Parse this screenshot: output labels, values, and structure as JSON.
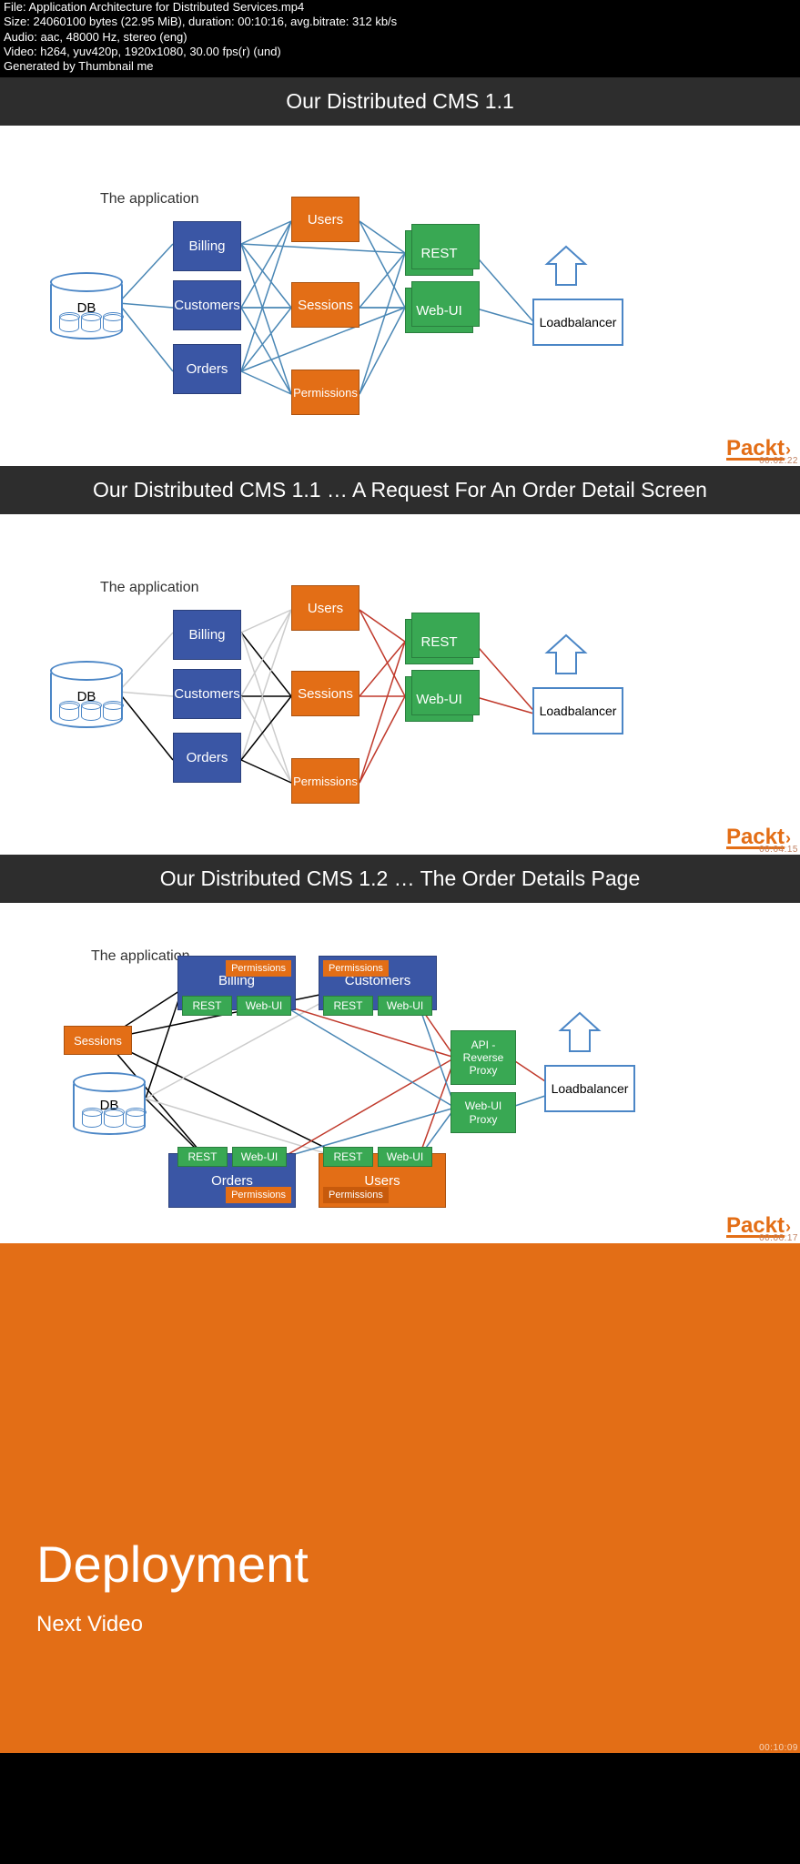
{
  "meta": {
    "file": "File: Application Architecture for Distributed Services.mp4",
    "size": "Size: 24060100 bytes (22.95 MiB), duration: 00:10:16, avg.bitrate: 312 kb/s",
    "audio": "Audio: aac, 48000 Hz, stereo (eng)",
    "video": "Video: h264, yuv420p, 1920x1080, 30.00 fps(r) (und)",
    "gen": "Generated by Thumbnail me"
  },
  "brand": "Packt",
  "db_label": "DB",
  "loadbalancer_label": "Loadbalancer",
  "app_label": "The application",
  "segments": {
    "s1": {
      "title": "Our Distributed CMS 1.1",
      "timestamp": "00:02:22",
      "nodes": {
        "billing": "Billing",
        "customers": "Customers",
        "orders": "Orders",
        "users": "Users",
        "sessions": "Sessions",
        "permissions": "Permissions",
        "rest": "REST",
        "webui": "Web-UI"
      }
    },
    "s2": {
      "title": "Our Distributed CMS 1.1 … A Request For An Order Detail Screen",
      "timestamp": "00:04:15",
      "nodes": {
        "billing": "Billing",
        "customers": "Customers",
        "orders": "Orders",
        "users": "Users",
        "sessions": "Sessions",
        "permissions": "Permissions",
        "rest": "REST",
        "webui": "Web-UI"
      }
    },
    "s3": {
      "title": "Our Distributed CMS 1.2 … The Order Details Page",
      "timestamp": "00:06:17",
      "nodes": {
        "billing": "Billing",
        "customers": "Customers",
        "orders": "Orders",
        "users": "Users",
        "sessions": "Sessions",
        "permissions": "Permissions",
        "rest": "REST",
        "webui": "Web-UI",
        "api_proxy": "API - Reverse Proxy",
        "webui_proxy": "Web-UI Proxy"
      }
    },
    "s4": {
      "title": "Deployment",
      "subtitle": "Next Video",
      "timestamp": "00:10:09"
    }
  }
}
